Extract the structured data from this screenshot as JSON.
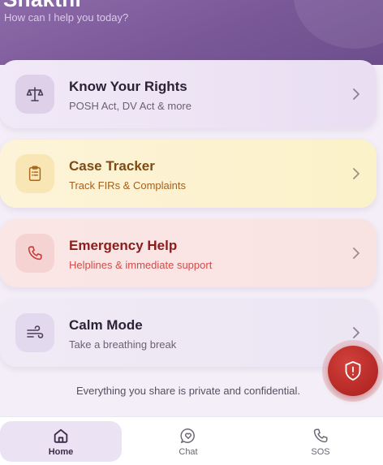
{
  "header": {
    "title": "Shakthi",
    "subtitle": "How can I help you today?"
  },
  "cards": [
    {
      "title": "Know Your Rights",
      "subtitle": "POSH Act, DV Act & more",
      "icon": "scales-icon"
    },
    {
      "title": "Case Tracker",
      "subtitle": "Track FIRs & Complaints",
      "icon": "clipboard-icon"
    },
    {
      "title": "Emergency Help",
      "subtitle": "Helplines & immediate support",
      "icon": "phone-icon"
    },
    {
      "title": "Calm Mode",
      "subtitle": "Take a breathing break",
      "icon": "wind-icon"
    }
  ],
  "privacy_note": "Everything you share is private and confidential.",
  "sos_button": {
    "icon": "shield-alert-icon"
  },
  "bottom_nav": {
    "items": [
      {
        "label": "Home",
        "icon": "home-icon",
        "active": true
      },
      {
        "label": "Chat",
        "icon": "chat-heart-icon",
        "active": false
      },
      {
        "label": "SOS",
        "icon": "phone-icon",
        "active": false
      }
    ]
  },
  "colors": {
    "header": "#7a5898",
    "sos": "#b52825",
    "rights_card": "#efe7f6",
    "case_card": "#fcf3d3",
    "emergency_card": "#fae4e4",
    "calm_card": "#eee8f5"
  }
}
